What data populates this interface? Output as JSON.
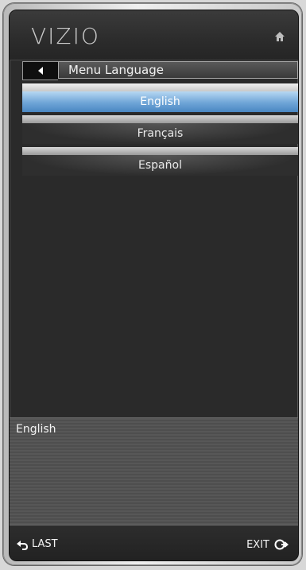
{
  "brand": {
    "logo": "VIZIO"
  },
  "icons": {
    "home": "home-icon",
    "back": "left-arrow-icon",
    "last": "return-icon",
    "exit": "exit-icon"
  },
  "header": {
    "title": "Menu Language"
  },
  "menu": {
    "items": [
      {
        "label": "English"
      },
      {
        "label": "Français"
      },
      {
        "label": "Español"
      }
    ],
    "selected_index": 0
  },
  "description": {
    "text": "English"
  },
  "footer": {
    "last_label": "LAST",
    "exit_label": "EXIT"
  },
  "colors": {
    "highlight": "#6fa5d7",
    "panel": "#2a2a2a"
  }
}
